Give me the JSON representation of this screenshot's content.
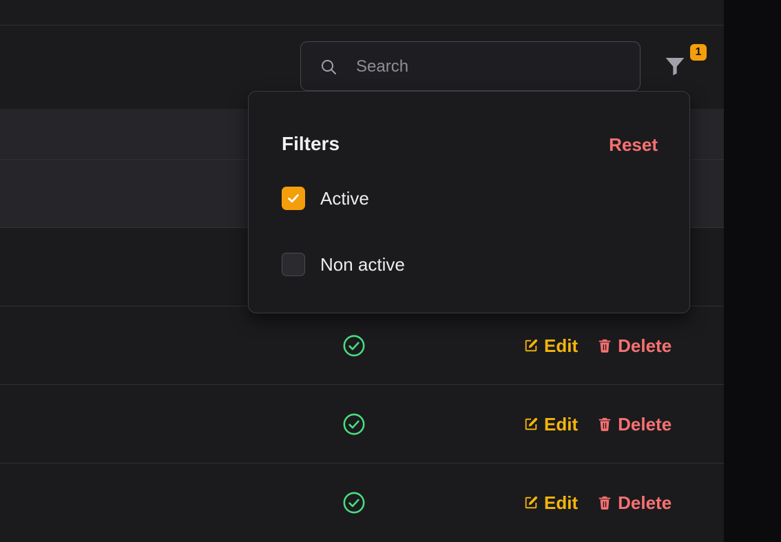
{
  "colors": {
    "accent": "#f59e0b",
    "danger": "#f87171",
    "success": "#4ade80",
    "panel_bg": "#1b1b1e"
  },
  "toolbar": {
    "search": {
      "placeholder": "Search",
      "icon": "search-icon"
    },
    "filter": {
      "icon": "funnel-icon",
      "badge_count": "1"
    }
  },
  "filters_dropdown": {
    "title": "Filters",
    "reset_label": "Reset",
    "options": [
      {
        "label": "Active",
        "checked": true
      },
      {
        "label": "Non active",
        "checked": false
      }
    ]
  },
  "table": {
    "rows": [
      {
        "status_icon": "check-circle-icon",
        "edit_label": "Edit",
        "delete_label": "Delete",
        "edit_icon": "pencil-square-icon",
        "delete_icon": "trash-icon"
      },
      {
        "status_icon": "check-circle-icon",
        "edit_label": "Edit",
        "delete_label": "Delete",
        "edit_icon": "pencil-square-icon",
        "delete_icon": "trash-icon"
      },
      {
        "status_icon": "check-circle-icon",
        "edit_label": "Edit",
        "delete_label": "Delete",
        "edit_icon": "pencil-square-icon",
        "delete_icon": "trash-icon"
      }
    ]
  }
}
